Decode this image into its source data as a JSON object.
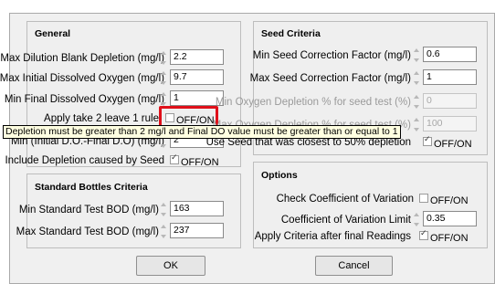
{
  "general": {
    "title": "General",
    "max_dilution_label": "Max Dilution Blank Depletion (mg/l)",
    "max_dilution_value": "2.2",
    "max_initial_do_label": "Max Initial Dissolved Oxygen (mg/l)",
    "max_initial_do_value": "9.7",
    "min_final_do_label": "Min Final Dissolved Oxygen (mg/l)",
    "min_final_do_value": "1",
    "apply_take2_label": "Apply take 2 leave 1 rule",
    "apply_take2_toggle": "OFF/ON",
    "apply_take2_checked": false,
    "min_initial_minus_final_label": "Min (Initial D.O.-Final D.O) (mg/l)",
    "min_initial_minus_final_value": "2",
    "include_depletion_label": "Include Depletion caused by Seed",
    "include_depletion_toggle": "OFF/ON",
    "include_depletion_checked": true
  },
  "tooltip": {
    "text": "Depletion must be greater than 2 mg/l and Final DO value must be greater than or equal to 1"
  },
  "standard_bottles": {
    "title": "Standard Bottles Criteria",
    "min_bod_label": "Min Standard Test BOD (mg/l)",
    "min_bod_value": "163",
    "max_bod_label": "Max Standard Test BOD (mg/l)",
    "max_bod_value": "237"
  },
  "seed": {
    "title": "Seed Criteria",
    "min_correction_label": "Min Seed Correction Factor (mg/l)",
    "min_correction_value": "0.6",
    "max_correction_label": "Max Seed Correction Factor (mg/l)",
    "max_correction_value": "1",
    "min_oxygen_label": "Min Oxygen Depletion % for seed test (%)",
    "min_oxygen_value": "0",
    "max_oxygen_label": "Max Oxygen Depletion % for seed test (%)",
    "max_oxygen_value": "100",
    "use_closest_label": "Use Seed that was closest to 50% depletion",
    "use_closest_toggle": "OFF/ON",
    "use_closest_checked": true
  },
  "options": {
    "title": "Options",
    "check_cov_label": "Check Coefficient of Variation",
    "check_cov_toggle": "OFF/ON",
    "check_cov_checked": false,
    "cov_limit_label": "Coefficient of Variation Limit",
    "cov_limit_value": "0.35",
    "apply_after_label": "Apply Criteria after final Readings",
    "apply_after_toggle": "OFF/ON",
    "apply_after_checked": true
  },
  "buttons": {
    "ok_label": "OK",
    "cancel_label": "Cancel"
  },
  "colors": {
    "highlight": "#e0101a",
    "tooltip_bg": "#ffffe1",
    "panel_bg": "#f0f0f0"
  }
}
